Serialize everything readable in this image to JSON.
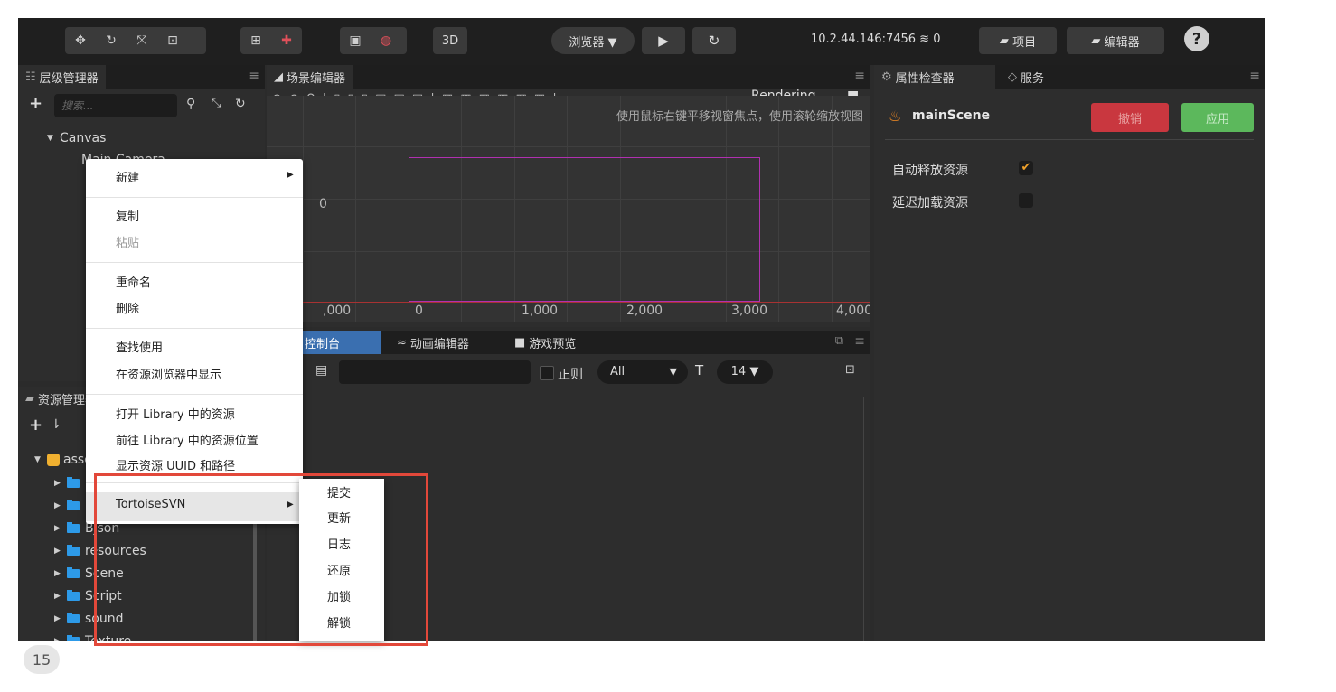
{
  "toolbar": {
    "preview_label": "浏览器 ▼",
    "btn_3d": "3D",
    "address": "10.2.44.146:7456",
    "conn_count": "0",
    "project_label": "项目",
    "editor_label": "编辑器",
    "help_label": "?"
  },
  "hierarchy": {
    "title": "层级管理器",
    "search_placeholder": "搜索...",
    "canvas": "Canvas",
    "main_camera": "Main Camera"
  },
  "scene": {
    "title": "场景编辑器",
    "rendering": "Rendering",
    "hint": "使用鼠标右键平移视窗焦点，使用滚轮缩放视图",
    "y_tick": "0",
    "x_ticks": [
      ",000",
      "0",
      "1,000",
      "2,000",
      "3,000",
      "4,000"
    ]
  },
  "console": {
    "tab_console": "控制台",
    "tab_anim": "动画编辑器",
    "tab_game": "游戏预览",
    "regex_label": "正则",
    "level": "All",
    "font_size": "14 ▼"
  },
  "assets": {
    "title": "资源管理器",
    "root": "assets",
    "items": [
      "Bjson",
      "resources",
      "Scene",
      "Script",
      "sound",
      "Texture"
    ]
  },
  "inspector": {
    "title": "属性检查器",
    "tab_service": "服务",
    "node_name": "mainScene",
    "revert_label": "撤销",
    "apply_label": "应用",
    "auto_release_label": "自动释放资源",
    "delay_load_label": "延迟加载资源"
  },
  "context_menu": {
    "new": "新建",
    "copy": "复制",
    "paste": "粘贴",
    "rename": "重命名",
    "delete": "删除",
    "find_usage": "查找使用",
    "show_in_browser": "在资源浏览器中显示",
    "open_library": "打开 Library 中的资源",
    "goto_library": "前往 Library 中的资源位置",
    "show_uuid": "显示资源 UUID 和路径",
    "svn": "TortoiseSVN"
  },
  "svn_menu": [
    "提交",
    "更新",
    "日志",
    "还原",
    "加锁",
    "解锁"
  ],
  "page_number": "15",
  "colors": {
    "accent_red": "#e2483a",
    "revert_red": "#c9373f",
    "apply_green": "#5cb85c",
    "checkbox_orange": "#f0a12a"
  }
}
